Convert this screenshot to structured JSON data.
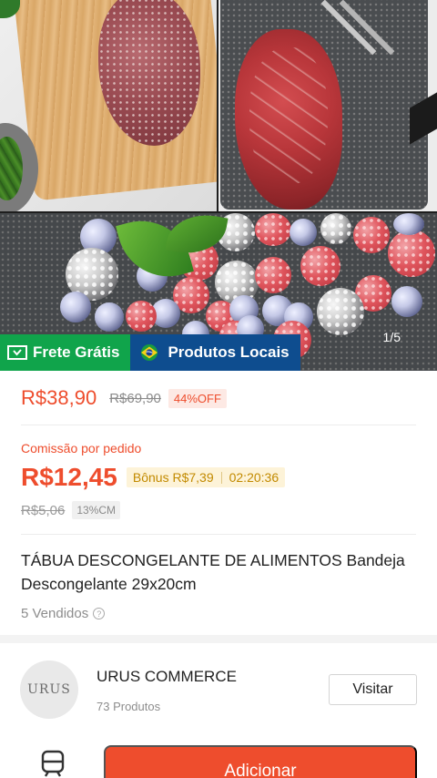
{
  "gallery": {
    "counter": "1/5",
    "badges": {
      "free_shipping": "Frete Grátis",
      "local_products": "Produtos Locais"
    }
  },
  "price": {
    "current": "R$38,90",
    "original": "R$69,90",
    "discount": "44%OFF"
  },
  "commission": {
    "label": "Comissão por pedido",
    "value": "R$12,45",
    "bonus": "Bônus R$7,39",
    "timer": "02:20:36",
    "old_value": "R$5,06",
    "rate": "13%CM"
  },
  "product": {
    "title": "TÁBUA DESCONGELANTE DE ALIMENTOS Bandeja Descongelante 29x20cm",
    "sold": "5 Vendidos"
  },
  "shop": {
    "logo_text": "URUS",
    "name": "URUS COMMERCE",
    "products": "73 Produtos",
    "visit_label": "Visitar"
  },
  "bottom_bar": {
    "add_label": "Adicionar"
  },
  "colors": {
    "accent": "#ee4d2d",
    "free_shipping_badge": "#10a44b",
    "local_badge": "#0e4d8f",
    "bonus_bg": "#fdf3d8"
  }
}
